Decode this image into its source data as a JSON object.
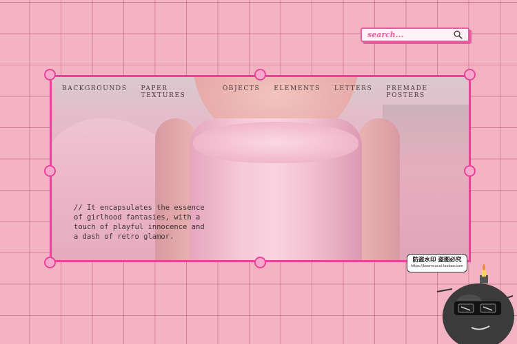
{
  "search": {
    "placeholder": "search..."
  },
  "nav": {
    "items": [
      {
        "label": "BACKGROUNDS"
      },
      {
        "label": "PAPER TEXTURES"
      },
      {
        "label": "OBJECTS"
      },
      {
        "label": "ELEMENTS"
      },
      {
        "label": "LETTERS"
      },
      {
        "label": "PREMADE POSTERS"
      }
    ]
  },
  "hero": {
    "caption": "// It encapsulates the essence of girlhood fantasies, with a touch of playful innocence and a dash of retro glamor."
  },
  "watermark": {
    "text": "防盗水印 盗图必究",
    "url": "https://boomsucai.taobao.com"
  },
  "colors": {
    "background": "#f4b3c3",
    "accent": "#e8449a",
    "handle_fill": "#f8a9cb"
  }
}
